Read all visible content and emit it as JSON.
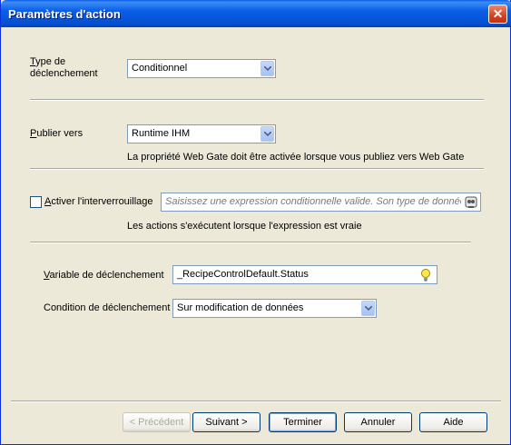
{
  "window": {
    "title": "Paramètres d'action"
  },
  "trigger_type": {
    "label_line1": "Type de",
    "label_line2": "déclenchement",
    "value": "Conditionnel"
  },
  "publish_to": {
    "label": "Publier vers",
    "value": "Runtime IHM",
    "note": "La propriété Web Gate doit être activée lorsque vous publiez vers Web Gate"
  },
  "interlock": {
    "label": "Activer l'interverrouillage",
    "checked": false,
    "placeholder": "Saisissez une expression conditionnelle valide. Son type de données",
    "note": "Les actions s'exécutent lorsque l'expression est vraie"
  },
  "trigger_variable": {
    "label": "Variable de déclenchement",
    "value": "_RecipeControlDefault.Status"
  },
  "trigger_condition": {
    "label": "Condition de déclenchement",
    "value": "Sur modification de données"
  },
  "buttons": {
    "previous": "< Précédent",
    "next": "Suivant >",
    "finish": "Terminer",
    "cancel": "Annuler",
    "help": "Aide"
  },
  "icons": {
    "close": "close-icon",
    "dropdown": "chevron-down-icon",
    "expression_builder": "expression-builder-icon",
    "tag_browser": "lightbulb-icon"
  }
}
